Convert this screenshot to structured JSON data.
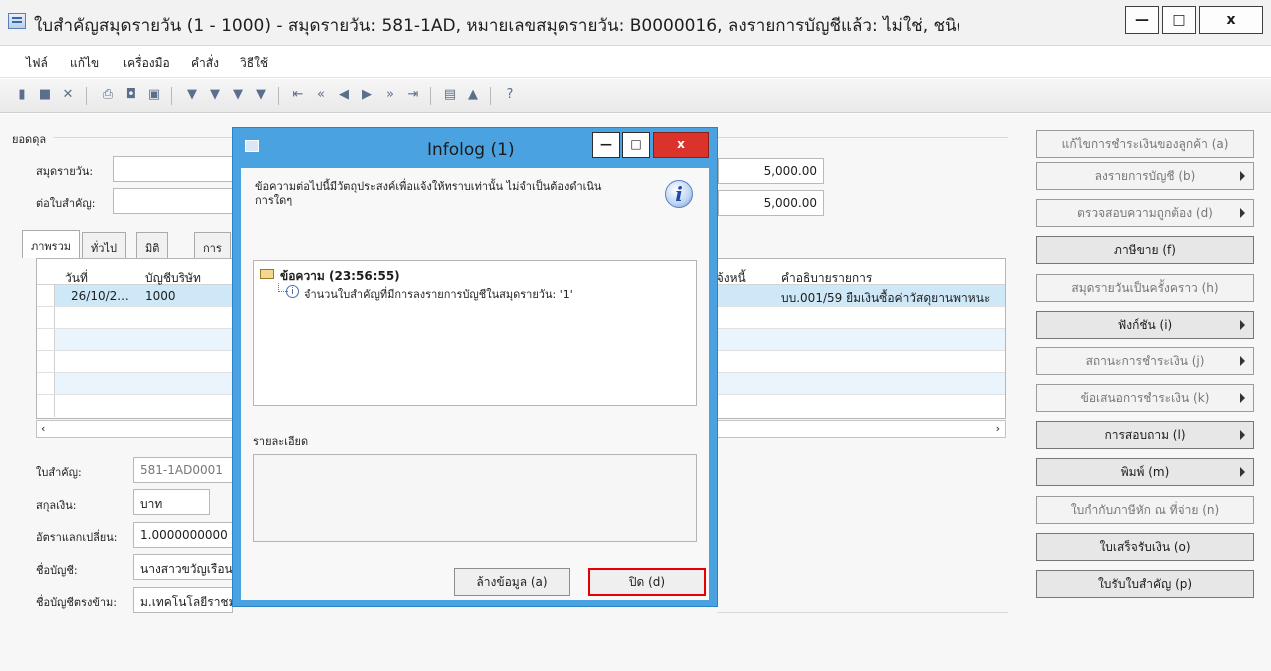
{
  "window": {
    "title": "ใบสำคัญสมุดรายวัน (1 - 1000) - สมุดรายวัน: 581-1AD, หมายเลขสมุดรายวัน: B0000016, ลงรายการบัญชีแล้ว: ไม่ใช่, ชนิดสมุดรายวัน: การชำระเงินของลู...",
    "minimize": "—",
    "maximize": "□",
    "close": "x"
  },
  "menu": [
    "ไฟล์",
    "แก้ไข",
    "เครื่องมือ",
    "คำสั่ง",
    "วิธีใช้"
  ],
  "balance": {
    "group_label": "ยอดดุล",
    "journal_label": "สมุดรายวัน:",
    "per_voucher_label": "ต่อใบสำคัญ:",
    "journal_value": "5,000.00",
    "voucher_value": "5,000.00"
  },
  "tabs": [
    "ภาพรวม",
    "ทั่วไป",
    "มิติ",
    "การ"
  ],
  "grid": {
    "headers": [
      "วันที่",
      "บัญชีบริษัท",
      "แจ้งหนี้",
      "คำอธิบายรายการ"
    ],
    "row": {
      "date": "26/10/2...",
      "company": "1000",
      "description": "บบ.001/59 ยืมเงินซื้อค่าวัสดุยานพาหนะ"
    }
  },
  "details": {
    "voucher_label": "ใบสำคัญ:",
    "voucher_value": "581-1AD0001",
    "currency_label": "สกุลเงิน:",
    "currency_value": "บาท",
    "rate_label": "อัตราแลกเปลี่ยน:",
    "rate_value": "1.0000000000",
    "account_name_label": "ชื่อบัญชี:",
    "account_name_value": "นางสาวขวัญเรือน",
    "offset_label": "ชื่อบัญชีตรงข้าม:",
    "offset_value": "ม.เทคโนโลยีราชม"
  },
  "right_buttons": [
    {
      "label": "แก้ไขการชำระเงินของลูกค้า (a)",
      "active": false,
      "arrow": false
    },
    {
      "label": "ลงรายการบัญชี (b)",
      "active": false,
      "arrow": true
    },
    {
      "label": "ตรวจสอบความถูกต้อง (d)",
      "active": false,
      "arrow": true
    },
    {
      "label": "ภาษีขาย (f)",
      "active": true,
      "arrow": false
    },
    {
      "label": "สมุดรายวันเป็นครั้งคราว (h)",
      "active": false,
      "arrow": false
    },
    {
      "label": "ฟังก์ชัน (i)",
      "active": true,
      "arrow": true
    },
    {
      "label": "สถานะการชำระเงิน (j)",
      "active": false,
      "arrow": true
    },
    {
      "label": "ข้อเสนอการชำระเงิน (k)",
      "active": false,
      "arrow": true
    },
    {
      "label": "การสอบถาม (l)",
      "active": true,
      "arrow": true
    },
    {
      "label": "พิมพ์ (m)",
      "active": true,
      "arrow": true
    },
    {
      "label": "ใบกำกับภาษีหัก ณ ที่จ่าย (n)",
      "active": false,
      "arrow": false
    },
    {
      "label": "ใบเสร็จรับเงิน (o)",
      "active": true,
      "arrow": false
    },
    {
      "label": "ใบรับใบสำคัญ (p)",
      "active": true,
      "arrow": false
    }
  ],
  "dialog": {
    "title": "Infolog (1)",
    "info_text": "ข้อความต่อไปนี้มีวัตถุประสงค์เพื่อแจ้งให้ทราบเท่านั้น ไม่จำเป็นต้องดำเนินการใดๆ",
    "message_header": "ข้อความ (23:56:55)",
    "message_item": "จำนวนใบสำคัญที่มีการลงรายการบัญชีในสมุดรายวัน: '1'",
    "details_label": "รายละเอียด",
    "clear_button": "ล้างข้อมูล (a)",
    "close_button": "ปิด (d)"
  },
  "colors": {
    "dialog_frame": "#4aa3e0",
    "close_red": "#d9332b",
    "highlight_red": "#e60000"
  }
}
